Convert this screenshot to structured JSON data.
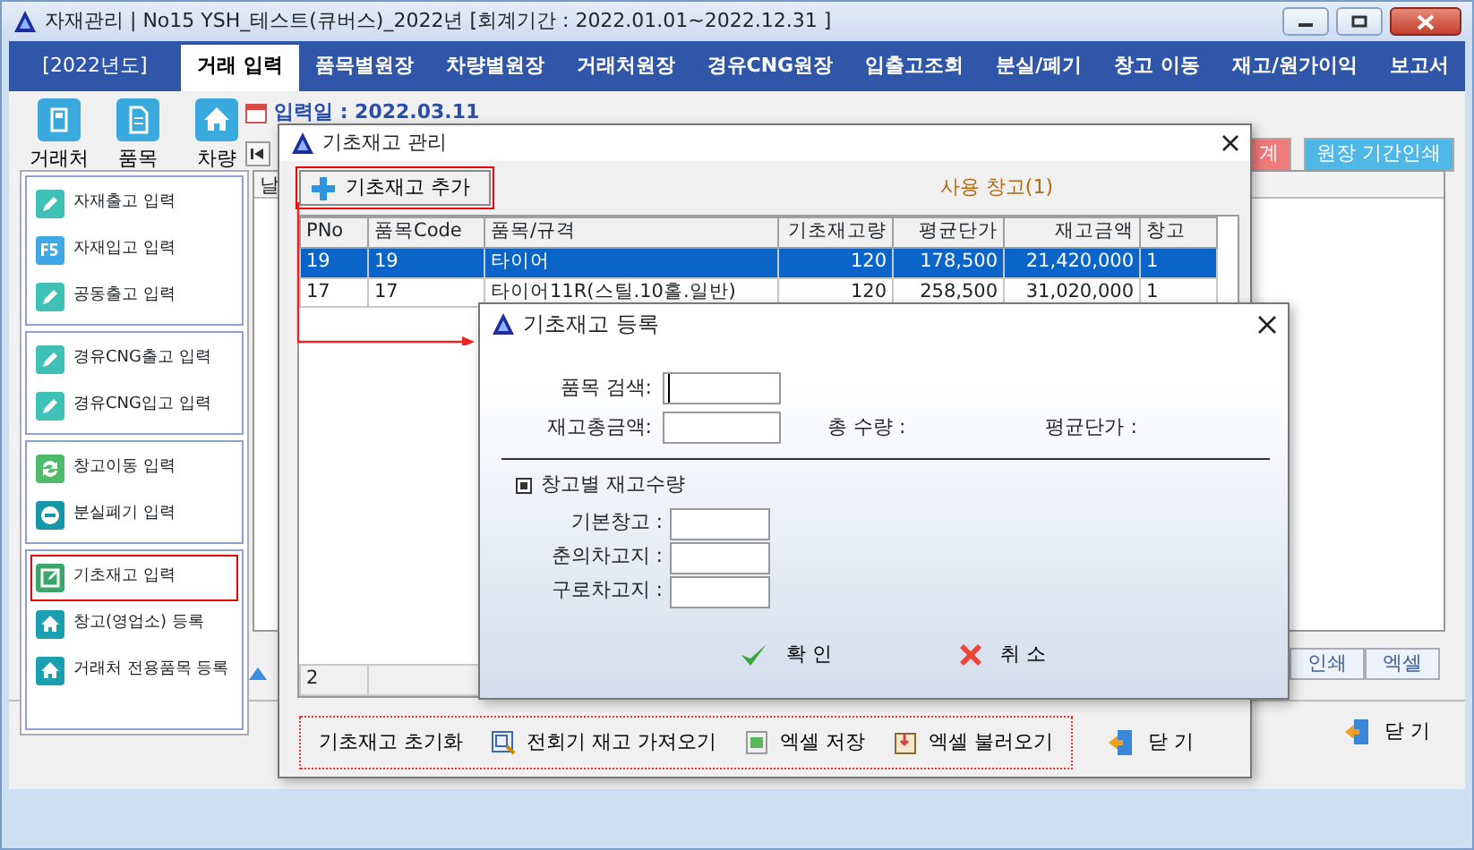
{
  "window": {
    "title": "자재관리 | No15 YSH_테스트(큐버스)_2022년 [회계기간 : 2022.01.01~2022.12.31 ]"
  },
  "menu": {
    "year": "[2022년도]",
    "tabs": [
      {
        "label": "거래 입력",
        "selected": true
      },
      {
        "label": "품목별원장",
        "selected": false
      },
      {
        "label": "차량별원장",
        "selected": false
      },
      {
        "label": "거래처원장",
        "selected": false
      },
      {
        "label": "경유CNG원장",
        "selected": false
      },
      {
        "label": "입출고조회",
        "selected": false
      },
      {
        "label": "분실/폐기",
        "selected": false
      },
      {
        "label": "창고 이동",
        "selected": false
      },
      {
        "label": "재고/원가이익",
        "selected": false
      },
      {
        "label": "보고서",
        "selected": false
      }
    ]
  },
  "toolbar": [
    {
      "label": "거래처",
      "kind": "save"
    },
    {
      "label": "품목",
      "kind": "doc"
    },
    {
      "label": "차량",
      "kind": "home"
    }
  ],
  "input_date": "입력일 : 2022.03.11",
  "sidebar": {
    "groups": [
      {
        "items": [
          {
            "label": "자재출고 입력",
            "kind": "pencil",
            "selected": false
          },
          {
            "label": "자재입고 입력",
            "kind": "f5",
            "selected": false
          },
          {
            "label": "공동출고 입력",
            "kind": "pencil",
            "selected": false
          }
        ]
      },
      {
        "items": [
          {
            "label": "경유CNG출고 입력",
            "kind": "pencil",
            "selected": false
          },
          {
            "label": "경유CNG입고 입력",
            "kind": "pencil",
            "selected": false
          }
        ]
      },
      {
        "items": [
          {
            "label": "창고이동 입력",
            "kind": "refresh",
            "selected": false
          },
          {
            "label": "분실폐기 입력",
            "kind": "minus",
            "selected": false
          }
        ]
      },
      {
        "items": [
          {
            "label": "기초재고 입력",
            "kind": "edit",
            "selected": true
          },
          {
            "label": "창고(영업소) 등록",
            "kind": "home",
            "selected": false
          },
          {
            "label": "거래처 전용품목 등록",
            "kind": "home",
            "selected": false
          }
        ]
      }
    ]
  },
  "top_buttons": [
    {
      "label": "계",
      "kind": "red"
    },
    {
      "label": "원장 기간인쇄",
      "kind": "blue"
    }
  ],
  "grid": {
    "column_1": "날"
  },
  "bottom_buttons": [
    "인쇄",
    "엑셀"
  ],
  "close_button": "닫 기",
  "dialog_manage": {
    "title": "기초재고 관리",
    "add_button": "기초재고 추가",
    "warehouse_count": "사용 창고(1)",
    "columns": [
      "PNo",
      "품목Code",
      "품목/규격",
      "기초재고량",
      "평균단가",
      "재고금액",
      "창고"
    ],
    "rows": [
      {
        "cells": [
          "19",
          "19",
          "타이어",
          "120",
          "178,500",
          "21,420,000",
          "1"
        ],
        "selected": true
      },
      {
        "cells": [
          "17",
          "17",
          "타이어11R(스틸.10홀.일반)",
          "120",
          "258,500",
          "31,020,000",
          "1"
        ],
        "selected": false
      }
    ],
    "footer": "2",
    "actions": [
      {
        "label": "기초재고 초기화",
        "kind": "text"
      },
      {
        "label": "전회기 재고 가져오기",
        "kind": "import"
      },
      {
        "label": "엑셀 저장",
        "kind": "excel"
      },
      {
        "label": "엑셀 불러오기",
        "kind": "load"
      }
    ],
    "close": "닫 기"
  },
  "dialog_register": {
    "title": "기초재고 등록",
    "fields": [
      {
        "label": "품목 검색:",
        "focused": true
      },
      {
        "label": "재고총금액:",
        "focused": false
      }
    ],
    "total_qty": "총 수량 :",
    "avg_price": "평균단가 :",
    "section": "창고별 재고수량",
    "warehouses": [
      {
        "label": "기본창고 :"
      },
      {
        "label": "춘의차고지 :"
      },
      {
        "label": "구로차고지 :"
      }
    ],
    "ok": "확 인",
    "cancel": "취 소"
  }
}
